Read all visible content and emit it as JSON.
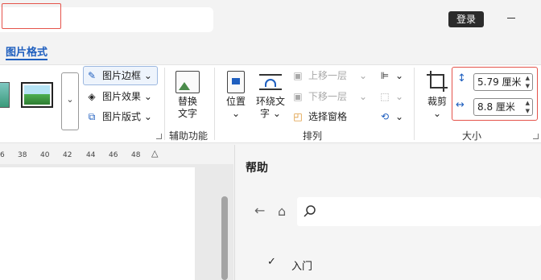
{
  "window": {
    "login_label": "登录"
  },
  "tabs": {
    "active_label": "图片格式"
  },
  "ribbon": {
    "picture_styles": {
      "border_label": "图片边框",
      "effects_label": "图片效果",
      "layout_label": "图片版式"
    },
    "accessibility": {
      "alt_text_line1": "替换",
      "alt_text_line2": "文字",
      "group_label": "辅助功能"
    },
    "arrange": {
      "position_label": "位置",
      "wrap_text_line1": "环绕文",
      "wrap_text_line2": "字",
      "bring_forward_label": "上移一层",
      "send_backward_label": "下移一层",
      "selection_pane_label": "选择窗格",
      "group_label": "排列"
    },
    "size": {
      "crop_label": "裁剪",
      "height_value": "5.79 厘米",
      "width_value": "8.8 厘米",
      "group_label": "大小"
    }
  },
  "ruler": {
    "ticks": [
      "6",
      "38",
      "40",
      "42",
      "44",
      "46",
      "48"
    ]
  },
  "help_pane": {
    "title": "帮助",
    "items": [
      {
        "label": "入门",
        "checked": true
      }
    ]
  },
  "colors": {
    "accent": "#1f5fbf",
    "highlight_border": "#e5534b"
  },
  "icons": [
    "search-icon",
    "minimize-icon",
    "picture-border-icon",
    "picture-effects-icon",
    "picture-layout-icon",
    "alt-text-icon",
    "position-icon",
    "wrap-text-icon",
    "bring-forward-icon",
    "send-backward-icon",
    "selection-pane-icon",
    "align-icon",
    "group-icon",
    "rotate-icon",
    "crop-icon",
    "height-icon",
    "width-icon",
    "back-arrow-icon",
    "home-icon",
    "checkmark-icon"
  ]
}
